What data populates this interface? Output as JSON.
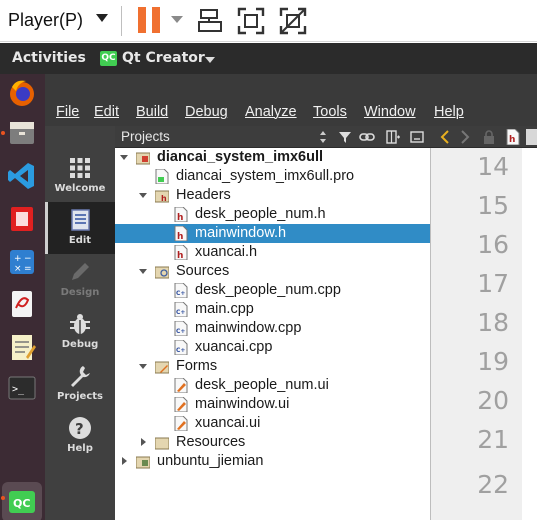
{
  "player": {
    "menu_label": "Player(P)"
  },
  "gnome": {
    "activities": "Activities",
    "app_badge": "QC",
    "app_name": "Qt Creator"
  },
  "menubar": {
    "items": [
      "File",
      "Edit",
      "Build",
      "Debug",
      "Analyze",
      "Tools",
      "Window",
      "Help"
    ]
  },
  "modes": [
    {
      "label": "Welcome",
      "icon": "grid-icon",
      "active": false,
      "enabled": true
    },
    {
      "label": "Edit",
      "icon": "document-icon",
      "active": true,
      "enabled": true
    },
    {
      "label": "Design",
      "icon": "pencil-icon",
      "active": false,
      "enabled": false
    },
    {
      "label": "Debug",
      "icon": "bug-icon",
      "active": false,
      "enabled": true
    },
    {
      "label": "Projects",
      "icon": "wrench-icon",
      "active": false,
      "enabled": true
    },
    {
      "label": "Help",
      "icon": "help-icon",
      "active": false,
      "enabled": true
    }
  ],
  "projects_pane": {
    "title": "Projects"
  },
  "tree": {
    "project_name": "diancai_system_imx6ull",
    "pro_file": "diancai_system_imx6ull.pro",
    "headers_label": "Headers",
    "headers": [
      "desk_people_num.h",
      "mainwindow.h",
      "xuancai.h"
    ],
    "sources_label": "Sources",
    "sources": [
      "desk_people_num.cpp",
      "main.cpp",
      "mainwindow.cpp",
      "xuancai.cpp"
    ],
    "forms_label": "Forms",
    "forms": [
      "desk_people_num.ui",
      "mainwindow.ui",
      "xuancai.ui"
    ],
    "resources_label": "Resources",
    "second_project": "unbuntu_jiemian",
    "selected": "mainwindow.h"
  },
  "editor": {
    "line_numbers": [
      "14",
      "15",
      "16",
      "17",
      "18",
      "19",
      "20",
      "21",
      "22"
    ]
  },
  "colors": {
    "selection": "#308cc6",
    "ubuntu_orange": "#e95420",
    "qt_green": "#41cd52"
  }
}
